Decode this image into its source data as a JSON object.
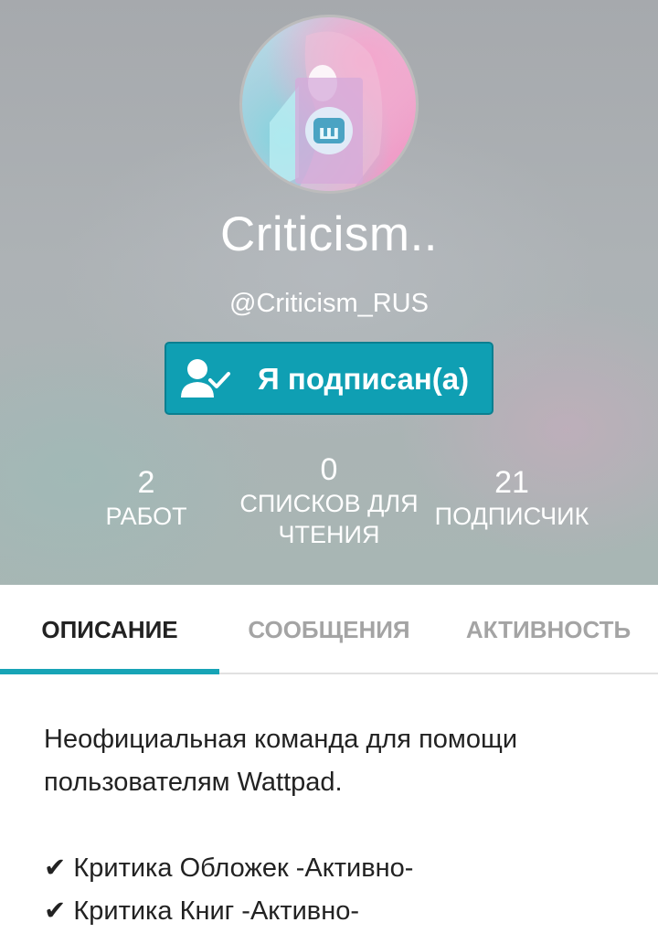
{
  "profile": {
    "display_name": "Criticism..",
    "username": "@Criticism_RUS",
    "avatar_icon": "wattpad-logo-icon"
  },
  "follow_button": {
    "label": "Я подписан(а)",
    "icon": "user-check-icon",
    "color": "#0f9fb3"
  },
  "stats": [
    {
      "value": "2",
      "label": "РАБОТ"
    },
    {
      "value": "0",
      "label_line1": "СПИСКОВ ДЛЯ",
      "label_line2": "ЧТЕНИЯ"
    },
    {
      "value": "21",
      "label": "ПОДПИСЧИК"
    }
  ],
  "tabs": [
    {
      "label": "ОПИСАНИЕ",
      "active": true
    },
    {
      "label": "СООБЩЕНИЯ",
      "active": false
    },
    {
      "label": "АКТИВНОСТЬ",
      "active": false
    }
  ],
  "accent_color": "#17a4b6",
  "description": {
    "line1": "Неофициальная команда для помощи",
    "line2": "пользователям Wattpad.",
    "line3": "✔ Критика Обложек -Активно-",
    "line4": "✔ Критика Книг -Активно-"
  }
}
